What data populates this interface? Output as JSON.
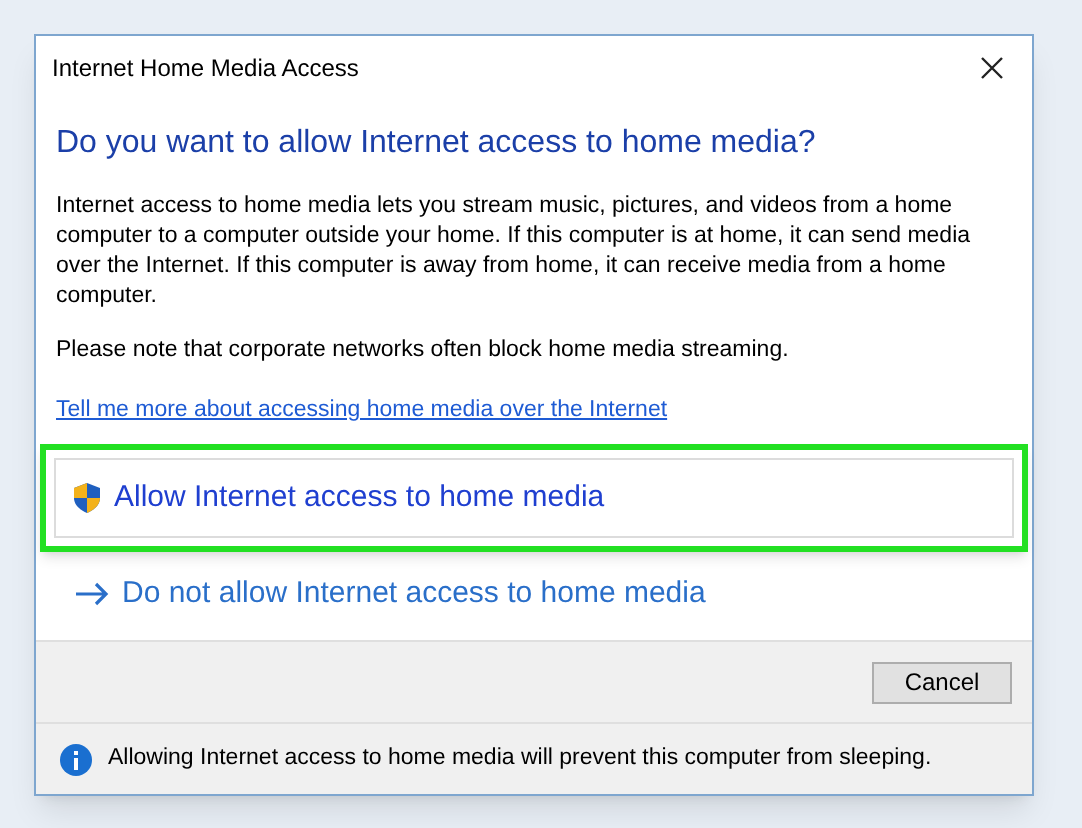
{
  "window": {
    "title": "Internet Home Media Access"
  },
  "heading": "Do you want to allow Internet access to home media?",
  "paragraphs": [
    "Internet access to home media lets you stream music, pictures, and videos from a home computer to a computer outside your home.  If this computer is at home, it can send media over the Internet.  If this computer is away from home, it can receive media from a home computer.",
    "Please note that corporate networks often block home media streaming."
  ],
  "link": "Tell me more about accessing home media over the Internet",
  "options": [
    {
      "kind": "elevated",
      "label": "Allow Internet access to home media",
      "highlighted": true
    },
    {
      "kind": "arrow",
      "label": "Do not allow Internet access to home media",
      "highlighted": false
    }
  ],
  "buttons": [
    "Cancel"
  ],
  "footer": {
    "text": "Allowing Internet access to home media will prevent this computer from sleeping."
  }
}
